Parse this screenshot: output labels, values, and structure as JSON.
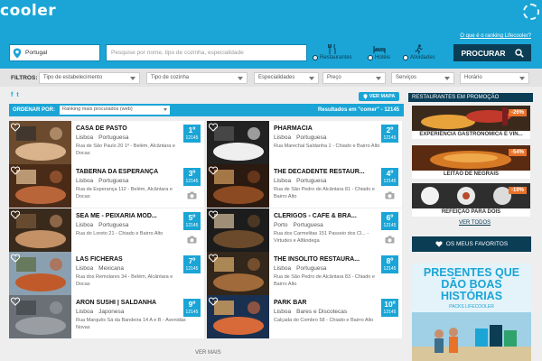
{
  "header": {
    "logo": "cooler",
    "ranking_link": "O que é o ranking Lifecooler?",
    "location_value": "Portugal",
    "search_placeholder": "Pesquise por nome, tipo de cozinha, especialidade",
    "categories": [
      {
        "label": "Restaurantes",
        "selected": true
      },
      {
        "label": "Hotéis",
        "selected": false
      },
      {
        "label": "Atividades",
        "selected": false
      }
    ],
    "search_button": "PROCURAR"
  },
  "filters": {
    "label": "FILTROS:",
    "items": [
      "Tipo de estabelecimento",
      "Tipo de cozinha",
      "Especialidades",
      "Preço",
      "Serviços",
      "Horário"
    ]
  },
  "social": {
    "facebook": "f",
    "twitter": "t"
  },
  "map_button": "VER MAPA",
  "sort": {
    "label": "ORDENAR POR:",
    "value": "Ranking mais procurados (web)",
    "results": "Resultados em \"comer\" - 12145"
  },
  "restaurants": [
    {
      "name": "CASA DE PASTO",
      "city": "Lisboa",
      "cuisine": "Portuguesa",
      "address": "Rua de São Paulo 20 1º - Belém, Alcântara e Docas",
      "rank": "1º",
      "total": "12145"
    },
    {
      "name": "PHARMACIA",
      "city": "Lisboa",
      "cuisine": "Portuguesa",
      "address": "Rua Marechal Saldanha 1 - Chiado e Bairro Alto",
      "rank": "2º",
      "total": "12145"
    },
    {
      "name": "TABERNA DA ESPERANÇA",
      "city": "Lisboa",
      "cuisine": "Portuguesa",
      "address": "Rua da Esperança 112 - Belém, Alcântara e Docas",
      "rank": "3º",
      "total": "12145"
    },
    {
      "name": "THE DECADENTE RESTAUR...",
      "city": "Lisboa",
      "cuisine": "Portuguesa",
      "address": "Rua de São Pedro de Alcântara 81 - Chiado e Bairro Alto",
      "rank": "4º",
      "total": "12145"
    },
    {
      "name": "SEA ME - PEIXARIA MOD...",
      "city": "Lisboa",
      "cuisine": "Portuguesa",
      "address": "Rua do Loreto 21 - Chiado e Bairro Alto",
      "rank": "5º",
      "total": "12145"
    },
    {
      "name": "CLÉRIGOS - CAFÉ & BRA...",
      "city": "Porto",
      "cuisine": "Portuguesa",
      "address": "Rua dos Carmelitas 151 Passeio dos Cl... - Virtudes e Alfândega",
      "rank": "6º",
      "total": "12145"
    },
    {
      "name": "LAS FICHERAS",
      "city": "Lisboa",
      "cuisine": "Mexicana",
      "address": "Rua dos Remolares 34 - Belém, Alcântara e Docas",
      "rank": "7º",
      "total": "12145"
    },
    {
      "name": "THE INSÓLITO RESTAURA...",
      "city": "Lisboa",
      "cuisine": "Portuguesa",
      "address": "Rua de São Pedro de Alcântara 83 - Chiado e Bairro Alto",
      "rank": "8º",
      "total": "12145"
    },
    {
      "name": "ARON SUSHI | SALDANHA",
      "city": "Lisboa",
      "cuisine": "Japonesa",
      "address": "Rua Marquês Sá da Bandeira 14 A e B - Avenidas Novas",
      "rank": "9º",
      "total": "12145"
    },
    {
      "name": "PARK BAR",
      "city": "Lisboa",
      "cuisine": "Bares e Discotecas",
      "address": "Calçada do Combro 58 - Chiado e Bairro Alto",
      "rank": "10º",
      "total": "12145"
    }
  ],
  "ver_mais": "VER MAIS",
  "sidebar": {
    "promo_title": "RESTAURANTES EM PROMOÇÃO",
    "promos": [
      {
        "title": "EXPERIÊNCIA GASTRONÓMICA E VIN...",
        "discount": "-26%"
      },
      {
        "title": "LEITÃO DE NEGRAIS",
        "discount": "-54%"
      },
      {
        "title": "REFEIÇÃO PARA DOIS",
        "discount": "-19%"
      }
    ],
    "ver_todos": "VER TODOS",
    "favorites": "OS MEUS FAVORITOS",
    "ad_title": "PRESENTES QUE DÃO BOAS HISTÓRIAS",
    "ad_sub": "PACKS LIFECOOLER"
  },
  "colors": {
    "brand": "#1aa5d6",
    "dark": "#0b3d55",
    "badge": "#e8722a"
  }
}
